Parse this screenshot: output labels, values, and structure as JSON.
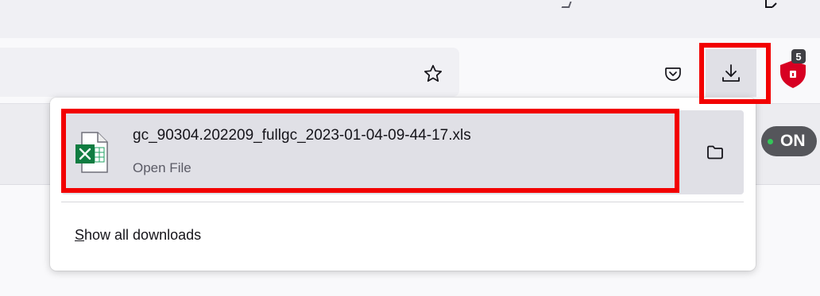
{
  "toolbar": {
    "bookmark_icon": "star-icon",
    "pocket_icon": "pocket-icon",
    "downloads_icon": "download-arrow-icon",
    "extension": {
      "icon": "shield-icon",
      "badge_count": "5",
      "color": "#d70022"
    }
  },
  "page": {
    "toggle_label": "ON",
    "toggle_dot_color": "#34c759"
  },
  "downloads_panel": {
    "items": [
      {
        "file_name": "gc_90304.202209_fullgc_2023-01-04-09-44-17.xls",
        "status": "Open File",
        "file_icon": "excel-file-icon",
        "action_icon": "folder-icon"
      }
    ],
    "show_all": {
      "accesskey": "S",
      "rest": "how all downloads"
    }
  },
  "annotation": {
    "highlight_color": "#f20000"
  }
}
